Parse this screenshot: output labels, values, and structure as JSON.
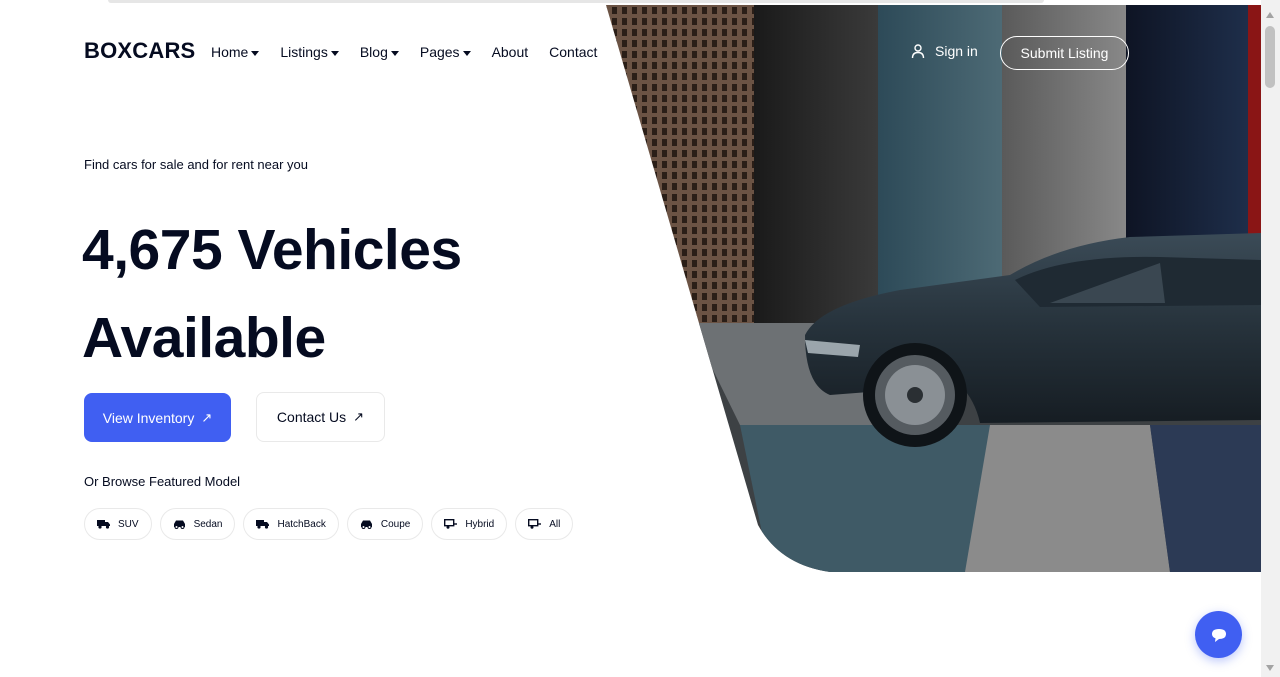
{
  "brand": {
    "logo": "BOXCARS"
  },
  "nav": {
    "items": [
      {
        "label": "Home",
        "dropdown": true
      },
      {
        "label": "Listings",
        "dropdown": true
      },
      {
        "label": "Blog",
        "dropdown": true
      },
      {
        "label": "Pages",
        "dropdown": true
      },
      {
        "label": "About",
        "dropdown": false
      },
      {
        "label": "Contact",
        "dropdown": false
      }
    ],
    "sign_in": "Sign in",
    "submit_listing": "Submit Listing"
  },
  "hero": {
    "eyebrow": "Find cars for sale and for rent near you",
    "headline_line1": "4,675 Vehicles",
    "headline_line2": "Available",
    "primary_button": "View Inventory",
    "secondary_button": "Contact Us",
    "browse_label": "Or Browse Featured Model",
    "models": [
      {
        "label": "SUV",
        "icon": "truck-icon"
      },
      {
        "label": "Sedan",
        "icon": "car-icon"
      },
      {
        "label": "HatchBack",
        "icon": "truck-icon"
      },
      {
        "label": "Coupe",
        "icon": "car-icon"
      },
      {
        "label": "Hybrid",
        "icon": "trailer-icon"
      },
      {
        "label": "All",
        "icon": "trailer-icon"
      }
    ],
    "image": {
      "subject": "dark sedan parked in front of colored wall panels",
      "icon": "hero-car-image"
    }
  },
  "colors": {
    "accent": "#405ff2",
    "text": "#050b20",
    "border": "#e9e9e9"
  },
  "chat": {
    "icon": "chat-bubble-icon"
  }
}
